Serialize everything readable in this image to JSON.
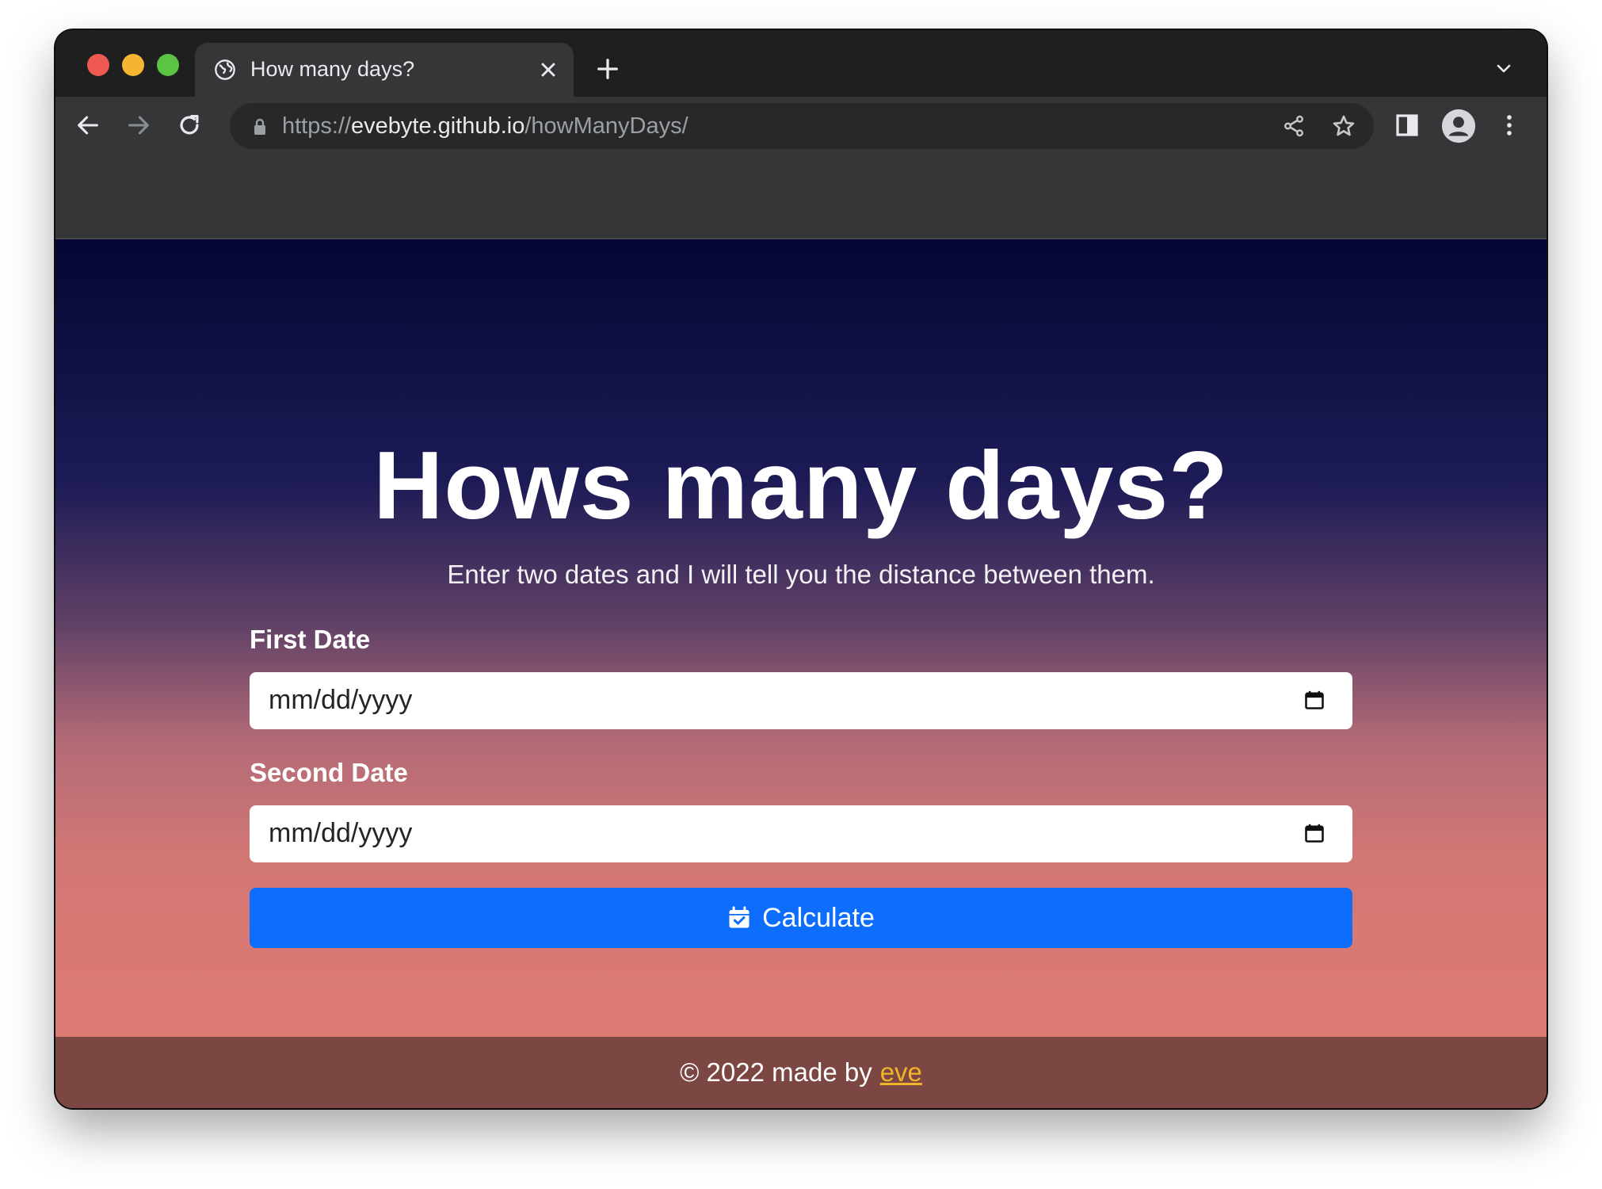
{
  "browser": {
    "tab": {
      "title": "How many days?"
    },
    "address_bar": {
      "scheme": "https://",
      "host": "evebyte.github.io",
      "path": "/howManyDays/"
    }
  },
  "page": {
    "headline": "Hows many days?",
    "lead": "Enter two dates and I will tell you the distance between them.",
    "first_date": {
      "label": "First Date",
      "placeholder": "mm/dd/yyyy"
    },
    "second_date": {
      "label": "Second Date",
      "placeholder": "mm/dd/yyyy"
    },
    "calculate_button": {
      "label": "Calculate",
      "icon": "calendar-check-icon"
    },
    "footer": {
      "text": "© 2022 made by",
      "link_text": "eve"
    }
  },
  "colors": {
    "button_primary": "#0d6efd",
    "footer_bg": "#7c4642",
    "footer_link": "#f0b429",
    "gradient_top": "#050633",
    "gradient_bottom": "#e17b73"
  }
}
